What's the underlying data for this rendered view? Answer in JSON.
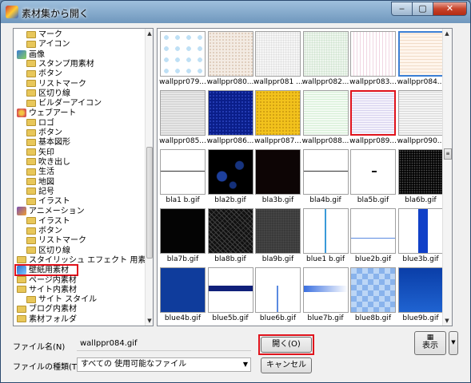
{
  "window": {
    "title": "素材集から開く",
    "min_label": "‒",
    "max_label": "▢",
    "close_label": "✕"
  },
  "tree": {
    "items": [
      {
        "label": "マーク",
        "icon": "folder-icon",
        "level": 2
      },
      {
        "label": "アイコン",
        "icon": "folder-icon",
        "level": 2
      },
      {
        "label": "画像",
        "icon": "image-group-icon",
        "level": 1
      },
      {
        "label": "スタンプ用素材",
        "icon": "folder-icon",
        "level": 2
      },
      {
        "label": "ボタン",
        "icon": "folder-icon",
        "level": 2
      },
      {
        "label": "リストマーク",
        "icon": "folder-icon",
        "level": 2
      },
      {
        "label": "区切り線",
        "icon": "folder-icon",
        "level": 2
      },
      {
        "label": "ビルダーアイコン",
        "icon": "folder-icon",
        "level": 2
      },
      {
        "label": "ウェブアート",
        "icon": "webart-icon",
        "level": 1
      },
      {
        "label": "ロゴ",
        "icon": "folder-icon",
        "level": 2
      },
      {
        "label": "ボタン",
        "icon": "folder-icon",
        "level": 2
      },
      {
        "label": "基本図形",
        "icon": "folder-icon",
        "level": 2
      },
      {
        "label": "矢印",
        "icon": "folder-icon",
        "level": 2
      },
      {
        "label": "吹き出し",
        "icon": "folder-icon",
        "level": 2
      },
      {
        "label": "生活",
        "icon": "folder-icon",
        "level": 2
      },
      {
        "label": "地図",
        "icon": "folder-icon",
        "level": 2
      },
      {
        "label": "記号",
        "icon": "folder-icon",
        "level": 2
      },
      {
        "label": "イラスト",
        "icon": "folder-icon",
        "level": 2
      },
      {
        "label": "アニメーション",
        "icon": "animation-icon",
        "level": 1
      },
      {
        "label": "イラスト",
        "icon": "folder-icon",
        "level": 2
      },
      {
        "label": "ボタン",
        "icon": "folder-icon",
        "level": 2
      },
      {
        "label": "リストマーク",
        "icon": "folder-icon",
        "level": 2
      },
      {
        "label": "区切り線",
        "icon": "folder-icon",
        "level": 2
      },
      {
        "label": "スタイリッシュ エフェクト 用素材",
        "icon": "folder-icon",
        "level": 1
      },
      {
        "label": "壁紙用素材",
        "icon": "wallpaper-icon",
        "level": 1,
        "selected": true
      },
      {
        "label": "ページ内素材",
        "icon": "folder-icon",
        "level": 1
      },
      {
        "label": "サイト内素材",
        "icon": "folder-icon",
        "level": 1
      },
      {
        "label": "サイト スタイル",
        "icon": "folder-icon",
        "level": 2
      },
      {
        "label": "ブログ内素材",
        "icon": "folder-icon",
        "level": 1
      },
      {
        "label": "素材フォルダ",
        "icon": "folder-icon",
        "level": 1
      }
    ]
  },
  "grid": {
    "items": [
      {
        "name": "wallppr079...",
        "pattern": "diamond-lightblue"
      },
      {
        "name": "wallppr080...",
        "pattern": "beige-speckle"
      },
      {
        "name": "wallppr081 ...",
        "pattern": "white-speckle"
      },
      {
        "name": "wallppr082...",
        "pattern": "green-speckle"
      },
      {
        "name": "wallppr083...",
        "pattern": "pink-lines"
      },
      {
        "name": "wallppr084...",
        "pattern": "peach-lines",
        "selected": true
      },
      {
        "name": "wallppr085...",
        "pattern": "gray-lines"
      },
      {
        "name": "wallppr086...",
        "pattern": "navy-dots"
      },
      {
        "name": "wallppr087...",
        "pattern": "yellow-dots"
      },
      {
        "name": "wallppr088...",
        "pattern": "mint-lines"
      },
      {
        "name": "wallppr089...",
        "pattern": "lavender-lines",
        "highlighted": true
      },
      {
        "name": "wallppr090...",
        "pattern": "gray-hlines"
      },
      {
        "name": "bla1 b.gif",
        "pattern": "white-rule"
      },
      {
        "name": "bla2b.gif",
        "pattern": "black-bokeh"
      },
      {
        "name": "bla3b.gif",
        "pattern": "black-dark"
      },
      {
        "name": "bla4b.gif",
        "pattern": "white-rule"
      },
      {
        "name": "bla5b.gif",
        "pattern": "white-dash"
      },
      {
        "name": "bla6b.gif",
        "pattern": "black-speckle"
      },
      {
        "name": "bla7b.gif",
        "pattern": "black-solid"
      },
      {
        "name": "bla8b.gif",
        "pattern": "black-texture"
      },
      {
        "name": "bla9b.gif",
        "pattern": "gray-dark"
      },
      {
        "name": "blue1 b.gif",
        "pattern": "white-vline"
      },
      {
        "name": "blue2b.gif",
        "pattern": "white-hline"
      },
      {
        "name": "blue3b.gif",
        "pattern": "white-vbar"
      },
      {
        "name": "blue4b.gif",
        "pattern": "blue-solid"
      },
      {
        "name": "blue5b.gif",
        "pattern": "white-navybar"
      },
      {
        "name": "blue6b.gif",
        "pattern": "white-spike"
      },
      {
        "name": "blue7b.gif",
        "pattern": "white-arrow"
      },
      {
        "name": "blue8b.gif",
        "pattern": "blue-checker"
      },
      {
        "name": "blue9b.gif",
        "pattern": "blue-gradient"
      },
      {
        "name": "",
        "pattern": "partial-blue"
      },
      {
        "name": "",
        "pattern": "partial-cyan"
      },
      {
        "name": "",
        "pattern": "partial-white"
      },
      {
        "name": "",
        "pattern": "partial-teal"
      },
      {
        "name": "",
        "pattern": "partial-white"
      },
      {
        "name": "",
        "pattern": "partial-white"
      }
    ]
  },
  "form": {
    "filename_label": "ファイル名(N)",
    "filename_value": "wallppr084.gif",
    "filetype_label": "ファイルの種類(T)",
    "filetype_value": "すべての 使用可能なファイル",
    "open_label": "開く(O)",
    "cancel_label": "キャンセル",
    "view_label": "表示",
    "view_icon": "view-grid-icon"
  },
  "colors": {
    "highlight_red": "#e0131c",
    "selection_blue": "#3b7fd4"
  }
}
